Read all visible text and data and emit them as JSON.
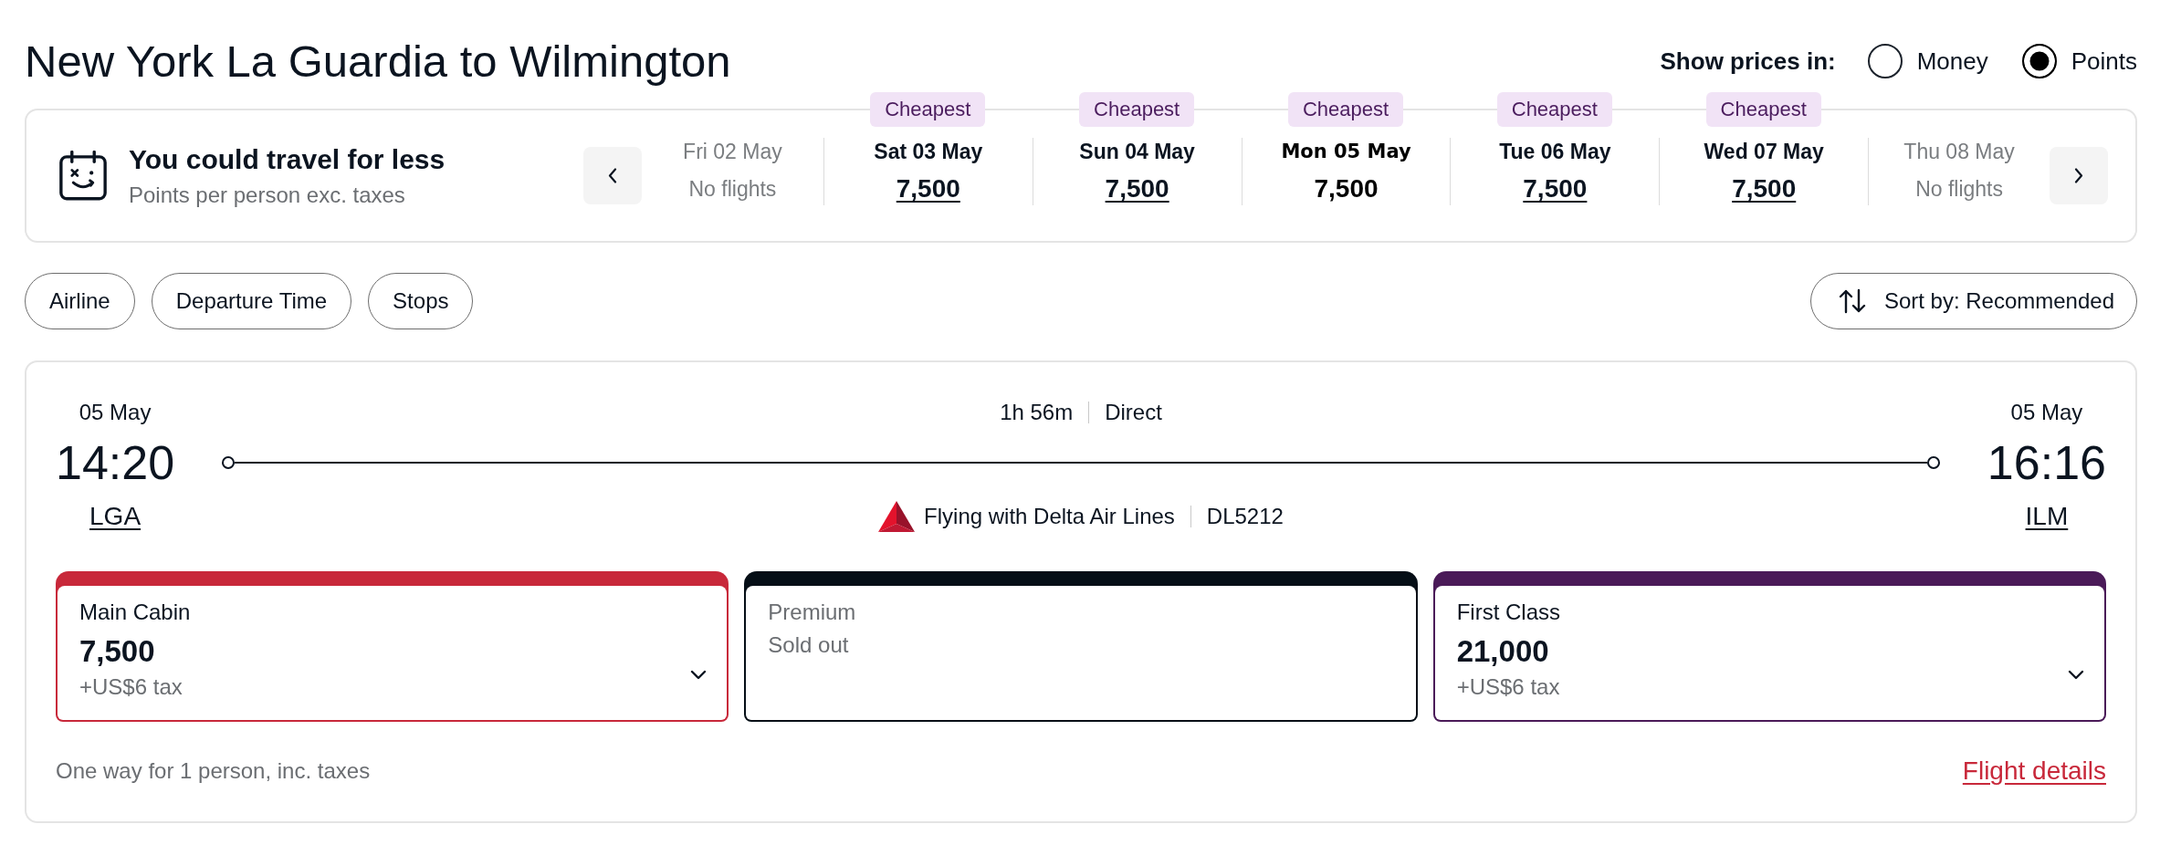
{
  "header": {
    "title": "New York La Guardia to Wilmington",
    "price_toggle": {
      "label": "Show prices in:",
      "options": [
        {
          "label": "Money",
          "selected": false
        },
        {
          "label": "Points",
          "selected": true
        }
      ]
    }
  },
  "date_strip": {
    "title": "You could travel for less",
    "subtitle": "Points per person exc. taxes",
    "days": [
      {
        "date": "Fri 02 May",
        "price": "No flights",
        "disabled": true,
        "selected": false
      },
      {
        "badge": "Cheapest",
        "date": "Sat 03 May",
        "price": "7,500",
        "disabled": false,
        "selected": false
      },
      {
        "badge": "Cheapest",
        "date": "Sun 04 May",
        "price": "7,500",
        "disabled": false,
        "selected": false
      },
      {
        "badge": "Cheapest",
        "date": "Mon 05 May",
        "price": "7,500",
        "disabled": false,
        "selected": true
      },
      {
        "badge": "Cheapest",
        "date": "Tue 06 May",
        "price": "7,500",
        "disabled": false,
        "selected": false
      },
      {
        "badge": "Cheapest",
        "date": "Wed 07 May",
        "price": "7,500",
        "disabled": false,
        "selected": false
      },
      {
        "date": "Thu 08 May",
        "price": "No flights",
        "disabled": true,
        "selected": false
      }
    ]
  },
  "filters": [
    "Airline",
    "Departure Time",
    "Stops"
  ],
  "sort": {
    "label": "Sort by: Recommended"
  },
  "flight": {
    "departure": {
      "date": "05 May",
      "time": "14:20",
      "airport": "LGA"
    },
    "duration": "1h 56m",
    "stops": "Direct",
    "arrival": {
      "date": "05 May",
      "time": "16:16",
      "airport": "ILM"
    },
    "airline": "Flying with Delta Air Lines",
    "flight_number": "DL5212",
    "fares": [
      {
        "cabin": "Main Cabin",
        "price": "7,500",
        "tax": "+US$6 tax",
        "disabled": false,
        "color": "#c8283a"
      },
      {
        "cabin": "Premium",
        "status": "Sold out",
        "disabled": true,
        "color": "#050e16"
      },
      {
        "cabin": "First Class",
        "price": "21,000",
        "tax": "+US$6 tax",
        "disabled": false,
        "color": "#4a1a58"
      }
    ],
    "note": "One way for 1 person, inc. taxes",
    "details_link": "Flight details"
  }
}
